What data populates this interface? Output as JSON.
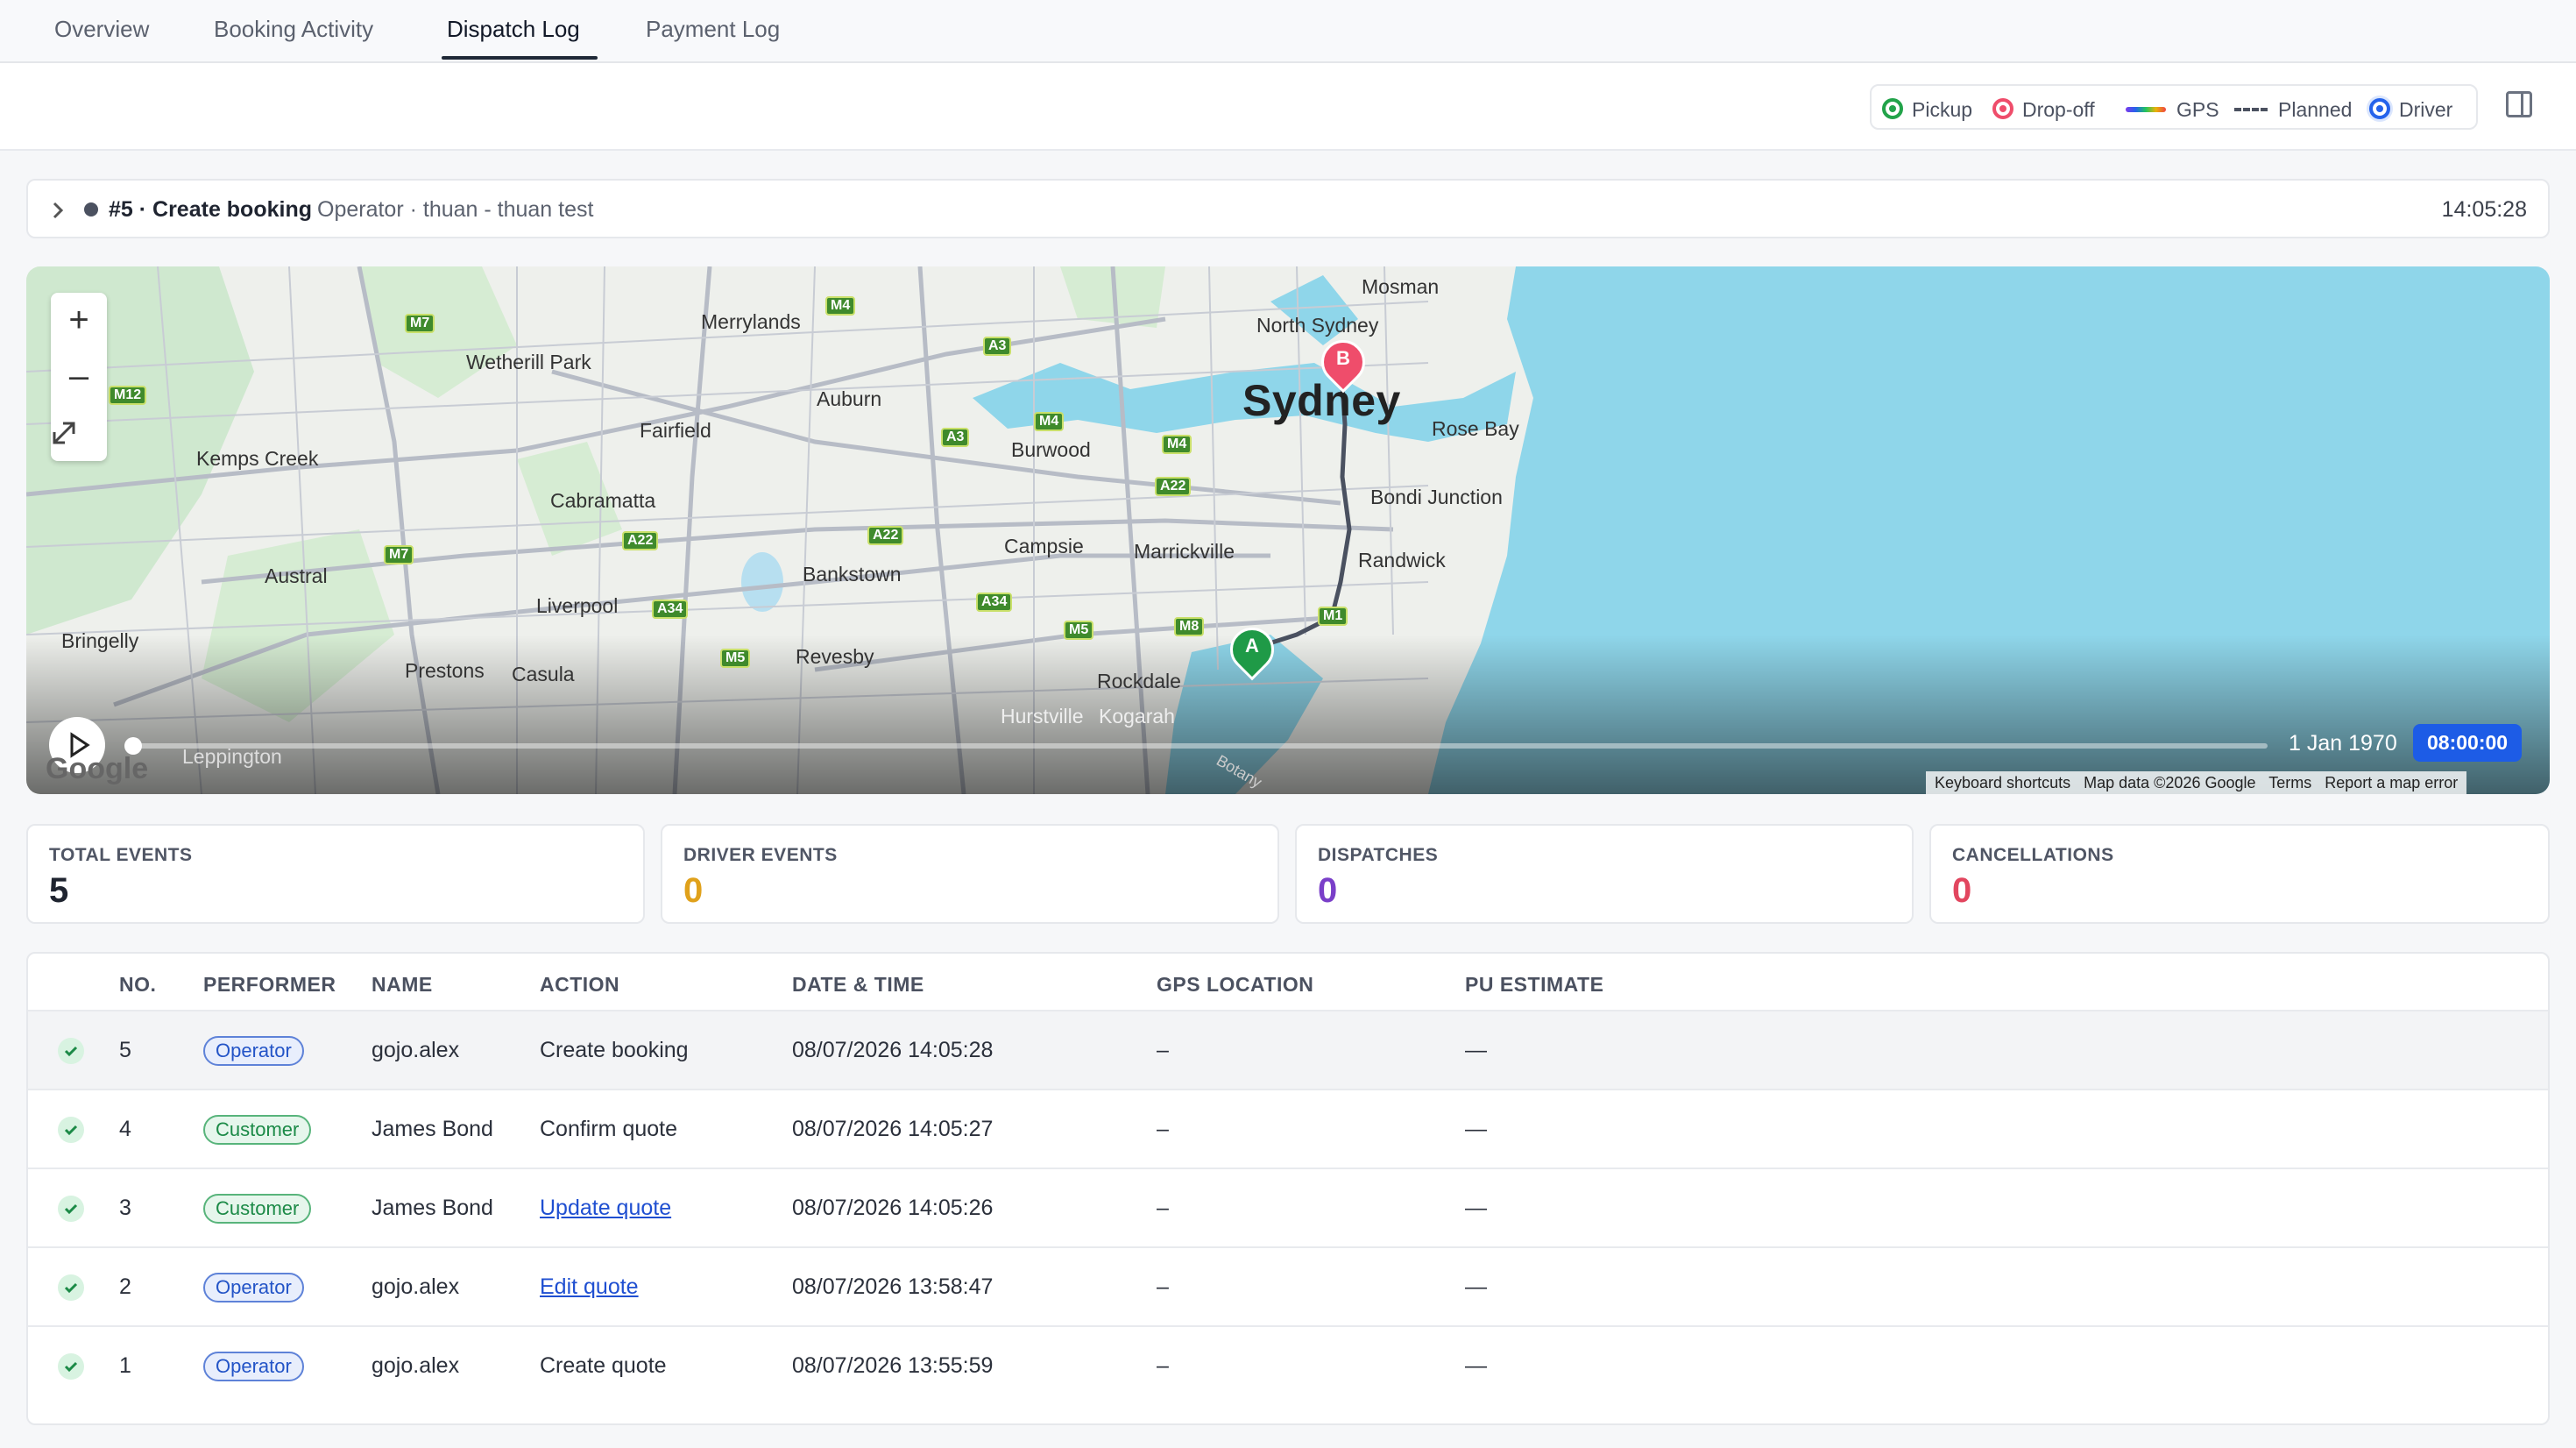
{
  "tabs": [
    {
      "label": "Overview"
    },
    {
      "label": "Booking Activity"
    },
    {
      "label": "Dispatch Log"
    },
    {
      "label": "Payment Log"
    }
  ],
  "active_tab": "Dispatch Log",
  "legend": {
    "pickup": "Pickup",
    "dropoff": "Drop-off",
    "gps": "GPS",
    "planned": "Planned",
    "driver": "Driver",
    "colors": {
      "pickup": "#22a34a",
      "dropoff": "#ef4d6b",
      "driver": "#2563eb"
    }
  },
  "event": {
    "title": "#5 · Create booking",
    "subtitle": "Operator · thuan - thuan test",
    "time": "14:05:28"
  },
  "map": {
    "city_label": "Sydney",
    "places": [
      "Mosman",
      "North Sydney",
      "Merrylands",
      "Wetherill Park",
      "Auburn",
      "Fairfield",
      "Burwood",
      "Rose Bay",
      "Kemps Creek",
      "Cabramatta",
      "Bondi Junction",
      "Campsie",
      "Marrickville",
      "Randwick",
      "Austral",
      "Bankstown",
      "Liverpool",
      "Bringelly",
      "Prestons",
      "Casula",
      "Revesby",
      "Rockdale",
      "Hurstville",
      "Kogarah",
      "Leppington",
      "Botany"
    ],
    "roads": [
      "M7",
      "M4",
      "M12",
      "A3",
      "M4",
      "A3",
      "M4",
      "A22",
      "A22",
      "M7",
      "A22",
      "A34",
      "A34",
      "M5",
      "M8",
      "M1",
      "M5"
    ],
    "pickup_marker": "A",
    "dropoff_marker": "B",
    "playback": {
      "date": "1 Jan 1970",
      "time": "08:00:00",
      "progress": 0
    },
    "attribution": [
      "Keyboard shortcuts",
      "Map data ©2026 Google",
      "Terms",
      "Report a map error"
    ],
    "logo": "Google",
    "zoom_in": "+",
    "zoom_out": "–",
    "fullscreen_icon": "expand-icon"
  },
  "stats": [
    {
      "label": "TOTAL EVENTS",
      "value": "5",
      "color": "#1f2430"
    },
    {
      "label": "DRIVER EVENTS",
      "value": "0",
      "color": "#e0a11b"
    },
    {
      "label": "DISPATCHES",
      "value": "0",
      "color": "#7a3fc9"
    },
    {
      "label": "CANCELLATIONS",
      "value": "0",
      "color": "#e2465f"
    }
  ],
  "table": {
    "headers": [
      "NO.",
      "PERFORMER",
      "NAME",
      "ACTION",
      "DATE & TIME",
      "GPS LOCATION",
      "PU ESTIMATE"
    ],
    "rows": [
      {
        "no": "5",
        "performer": "Operator",
        "name": "gojo.alex",
        "action": "Create booking",
        "datetime": "08/07/2026 14:05:28",
        "gps": "–",
        "pu": "—"
      },
      {
        "no": "4",
        "performer": "Customer",
        "name": "James Bond",
        "action": "Confirm quote",
        "datetime": "08/07/2026 14:05:27",
        "gps": "–",
        "pu": "—"
      },
      {
        "no": "3",
        "performer": "Customer",
        "name": "James Bond",
        "action": "Update quote",
        "datetime": "08/07/2026 14:05:26",
        "gps": "–",
        "pu": "—"
      },
      {
        "no": "2",
        "performer": "Operator",
        "name": "gojo.alex",
        "action": "Edit quote",
        "datetime": "08/07/2026 13:58:47",
        "gps": "–",
        "pu": "—"
      },
      {
        "no": "1",
        "performer": "Operator",
        "name": "gojo.alex",
        "action": "Create quote",
        "datetime": "08/07/2026 13:55:59",
        "gps": "–",
        "pu": "—"
      }
    ]
  }
}
